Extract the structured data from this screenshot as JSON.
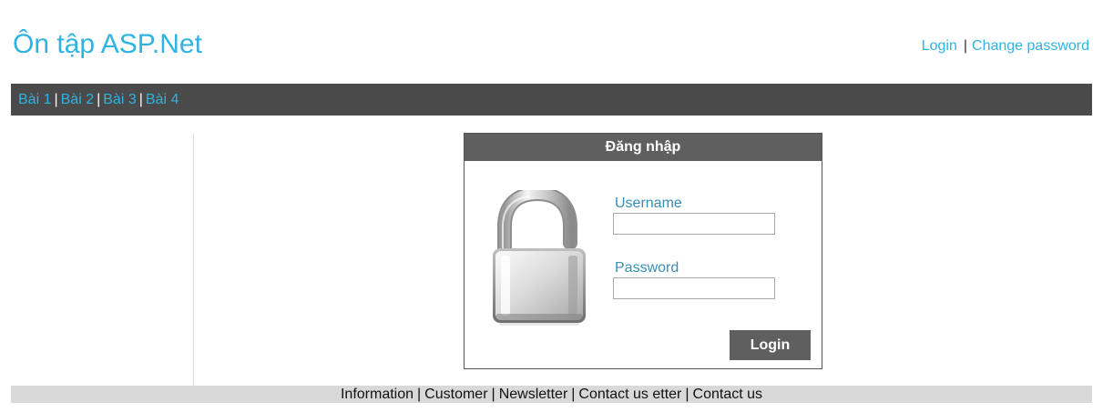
{
  "header": {
    "site_title": "Ôn tập ASP.Net",
    "links": {
      "login": "Login",
      "separator": "|",
      "change_password": "Change password"
    }
  },
  "nav": {
    "items": [
      "Bài 1",
      "Bài 2",
      "Bài 3",
      "Bài 4"
    ],
    "separator": "|"
  },
  "login_form": {
    "title": "Đăng nhập",
    "username_label": "Username",
    "username_value": "",
    "password_label": "Password",
    "password_value": "",
    "submit_label": "Login",
    "icon": "padlock-open-icon"
  },
  "footer": {
    "items": [
      "Information",
      "Customer",
      "Newsletter",
      "Contact us etter",
      "Contact us"
    ],
    "separator": "|"
  },
  "colors": {
    "link": "#2fb3e0",
    "navbar_bg": "#4a4a4a",
    "box_header_bg": "#5f5f5f",
    "label": "#3a8db5",
    "footer_bg": "#d9d9d9"
  }
}
